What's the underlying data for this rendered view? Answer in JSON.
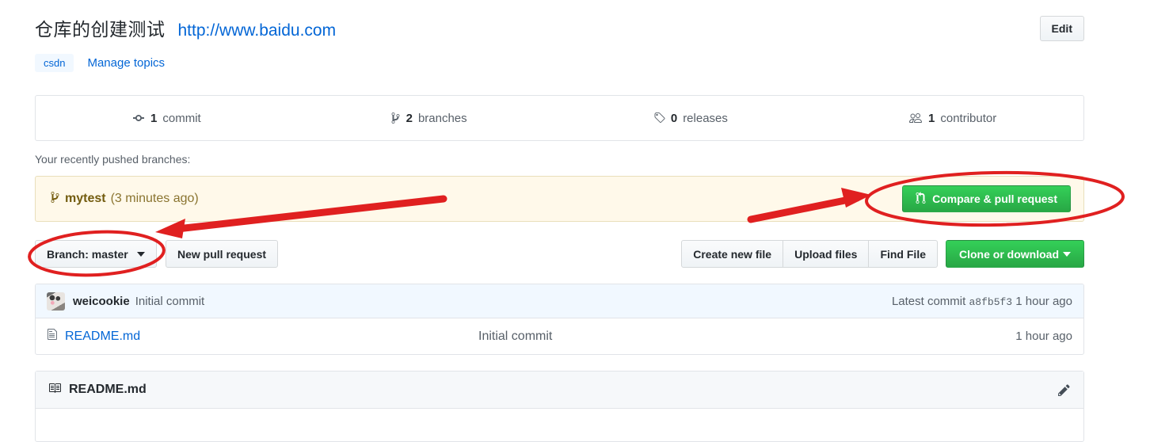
{
  "header": {
    "repo_title": "仓库的创建测试",
    "repo_url": "http://www.baidu.com",
    "edit_label": "Edit",
    "topic_tag": "csdn",
    "manage_topics_label": "Manage topics"
  },
  "stats": [
    {
      "icon": "commit-icon",
      "count": "1",
      "label": "commit"
    },
    {
      "icon": "branch-icon",
      "count": "2",
      "label": "branches"
    },
    {
      "icon": "tag-icon",
      "count": "0",
      "label": "releases"
    },
    {
      "icon": "contributors-icon",
      "count": "1",
      "label": "contributor"
    }
  ],
  "pushed_branches": {
    "label": "Your recently pushed branches:",
    "branch_name": "mytest",
    "branch_age": "(3 minutes ago)",
    "compare_pr_label": "Compare & pull request"
  },
  "action_bar": {
    "branch_select_label": "Branch: master",
    "new_pull_request_label": "New pull request",
    "create_new_file_label": "Create new file",
    "upload_files_label": "Upload files",
    "find_file_label": "Find File",
    "clone_or_download_label": "Clone or download"
  },
  "commit_bar": {
    "author": "weicookie",
    "message": "Initial commit",
    "latest_commit_label": "Latest commit",
    "sha": "a8fb5f3",
    "age": "1 hour ago"
  },
  "files": [
    {
      "name": "README.md",
      "message": "Initial commit",
      "age": "1 hour ago"
    }
  ],
  "readme": {
    "title": "README.md",
    "edit_icon": "pencil-icon"
  },
  "annotations": {
    "color": "#e02020",
    "ellipse_branch_label": "branch-master-highlight",
    "ellipse_pr_label": "compare-pull-request-highlight",
    "arrow_left_label": "arrow-to-branch-selector",
    "arrow_right_label": "arrow-to-compare-pull-request"
  },
  "colors": {
    "link": "#0366d6",
    "green_button": "#28a745",
    "banner_bg": "#fff9ea",
    "annotation_red": "#e02020"
  }
}
